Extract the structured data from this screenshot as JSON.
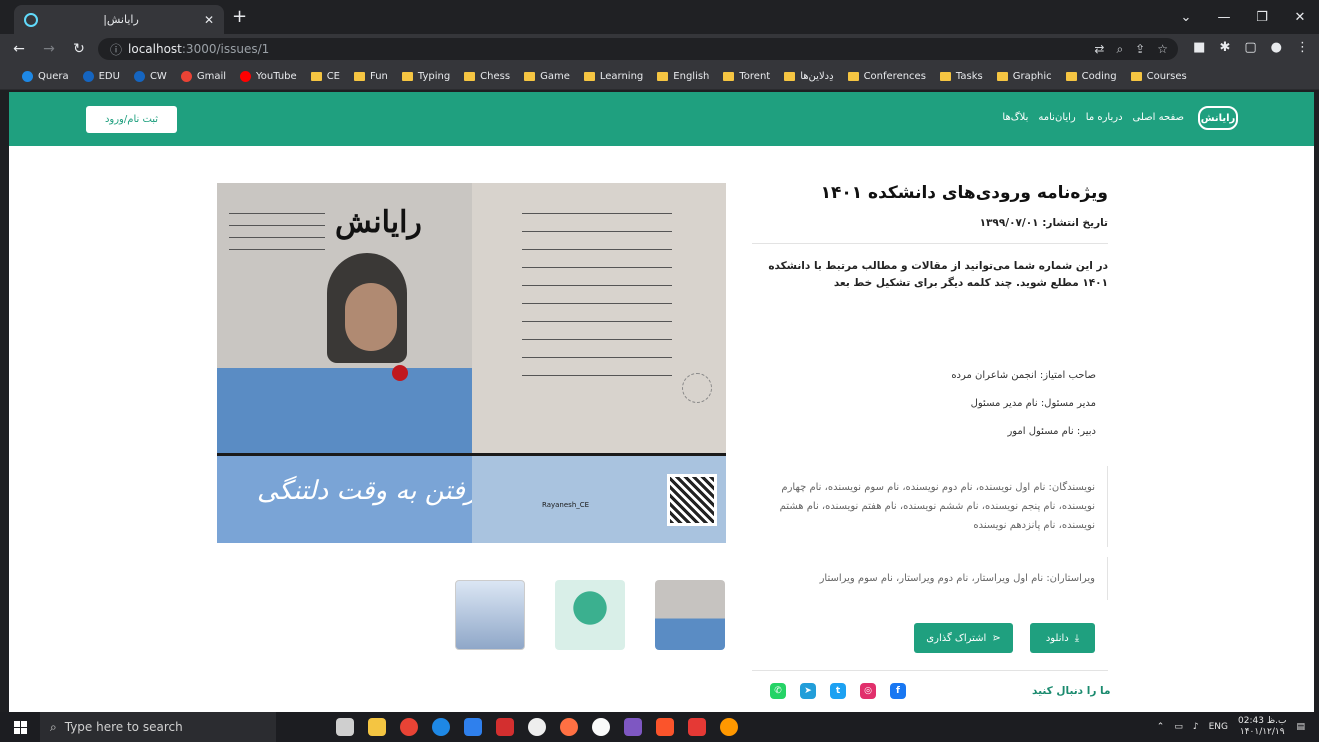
{
  "browser": {
    "tab_title": "رایانش|",
    "url_host": "localhost",
    "url_path": ":3000/issues/1",
    "window_controls": [
      "⌄",
      "—",
      "❐",
      "✕"
    ],
    "bookmarks": [
      {
        "label": "Quera",
        "kind": "circle",
        "color": "#1e88e5"
      },
      {
        "label": "EDU",
        "kind": "circle",
        "color": "#1565c0"
      },
      {
        "label": "CW",
        "kind": "circle",
        "color": "#1565c0"
      },
      {
        "label": "Gmail",
        "kind": "gmail",
        "color": "#ea4335"
      },
      {
        "label": "YouTube",
        "kind": "circle",
        "color": "#ff0000"
      },
      {
        "label": "CE",
        "kind": "folder"
      },
      {
        "label": "Fun",
        "kind": "folder"
      },
      {
        "label": "Typing",
        "kind": "folder"
      },
      {
        "label": "Chess",
        "kind": "folder"
      },
      {
        "label": "Game",
        "kind": "folder"
      },
      {
        "label": "Learning",
        "kind": "folder"
      },
      {
        "label": "English",
        "kind": "folder"
      },
      {
        "label": "Torent",
        "kind": "folder"
      },
      {
        "label": "دِدلاین‌ها",
        "kind": "folder"
      },
      {
        "label": "Conferences",
        "kind": "folder"
      },
      {
        "label": "Tasks",
        "kind": "folder"
      },
      {
        "label": "Graphic",
        "kind": "folder"
      },
      {
        "label": "Coding",
        "kind": "folder"
      },
      {
        "label": "Courses",
        "kind": "folder"
      }
    ]
  },
  "site": {
    "logo": "رایانش",
    "menu": [
      "صفحه اصلی",
      "درباره ما",
      "رایان‌نامه",
      "بلاگ‌ها"
    ],
    "login_label": "ثبت نام/ورود"
  },
  "cover": {
    "masthead": "رایانش",
    "calligraphy": "به هنگام رفتن به وقت دلتنگی",
    "handle": "Rayanesh_CE"
  },
  "issue": {
    "title": "ویژه‌نامه ورودی‌های دانشکده ۱۴۰۱",
    "date": "تاریخ انتشار: ۱۳۹۹/۰۷/۰۱",
    "description": "در این شماره شما می‌توانید از مقالات و مطالب مرتبط با دانشکده ۱۴۰۱ مطلع شوید. چند کلمه دیگر برای تشکیل خط بعد",
    "owner": "صاحب امتیاز: انجمن شاعران مرده",
    "manager": "مدیر مسئول: نام مدیر مسئول",
    "secretary": "دبیر: نام مسئول امور",
    "writers": "نویسندگان: نام اول نویسنده، نام دوم نویسنده، نام سوم نویسنده، نام چهارم نویسنده، نام پنجم نویسنده، نام ششم نویسنده، نام هفتم نویسنده، نام هشتم نویسنده، نام پانزدهم نویسنده",
    "editors": "ویراستاران: نام اول ویراستار، نام دوم ویراستار، نام سوم ویراستار",
    "download_label": "دانلود",
    "share_label": "اشتراک گذاری",
    "follow_label": "ما را دنبال کنید"
  },
  "social": [
    {
      "name": "whatsapp",
      "glyph": "✆",
      "color": "#25d366"
    },
    {
      "name": "telegram",
      "glyph": "➤",
      "color": "#229ed9"
    },
    {
      "name": "twitter",
      "glyph": "t",
      "color": "#1da1f2"
    },
    {
      "name": "instagram",
      "glyph": "◎",
      "color": "#e1306c"
    },
    {
      "name": "facebook",
      "glyph": "f",
      "color": "#1877f2"
    }
  ],
  "taskbar": {
    "search_placeholder": "Type here to search",
    "lang": "ENG",
    "time": "02:43 ب.ظ",
    "date": "۱۴۰۱/۱۲/۱۹"
  },
  "colors": {
    "brand": "#1fa07f"
  }
}
